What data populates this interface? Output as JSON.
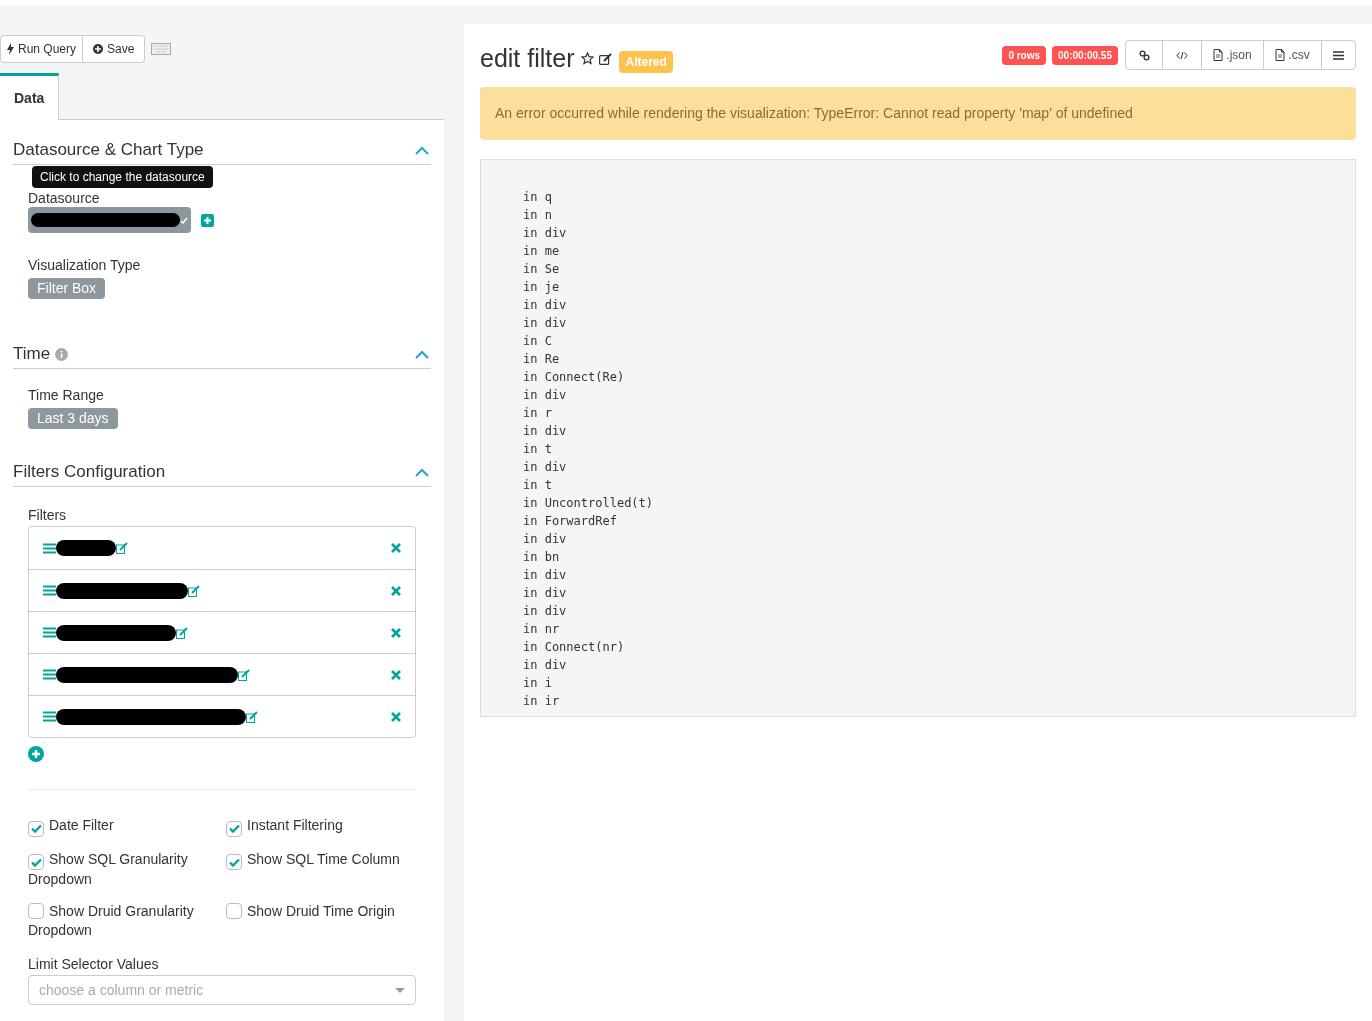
{
  "toolbar": {
    "run_button": "Run Query",
    "save_button": "Save"
  },
  "tabs": [
    {
      "label": "Data",
      "selected": true
    }
  ],
  "sections": [
    {
      "kind": "datasource",
      "title": "Datasource & Chart Type",
      "expanded": true,
      "datasource_label": "Datasource",
      "tooltip": "Click to change the datasource",
      "viz_label": "Visualization Type",
      "viz_value": "Filter Box"
    },
    {
      "kind": "time",
      "title": "Time",
      "expanded": true,
      "time_label": "Time Range",
      "time_value": "Last 3 days"
    },
    {
      "kind": "filters",
      "title": "Filters Configuration",
      "expanded": true,
      "filters_label": "Filters",
      "filters": [
        {
          "kind": "redacted"
        },
        {
          "kind": "redacted"
        },
        {
          "kind": "redacted"
        },
        {
          "kind": "redacted"
        },
        {
          "kind": "redacted"
        }
      ],
      "checkboxes": [
        {
          "label": "Date Filter",
          "checked": true
        },
        {
          "label": "Instant Filtering",
          "checked": true
        },
        {
          "label": "Show SQL Granularity Dropdown",
          "checked": true
        },
        {
          "label": "Show SQL Time Column",
          "checked": true
        },
        {
          "label": "Show Druid Granularity Dropdown",
          "checked": false
        },
        {
          "label": "Show Druid Time Origin",
          "checked": false
        }
      ],
      "limit_label": "Limit Selector Values",
      "limit_placeholder": "choose a column or metric"
    }
  ],
  "chart": {
    "title": "edit filter",
    "badge": "Altered",
    "rows": "0 rows",
    "timer": "00:00:00.55",
    "json_button": ".json",
    "csv_button": ".csv",
    "error": "An error occurred while rendering the visualization: TypeError: Cannot read property 'map' of undefined",
    "stack": [
      "in q",
      "in n",
      "in div",
      "in me",
      "in Se",
      "in je",
      "in div",
      "in div",
      "in C",
      "in Re",
      "in Connect(Re)",
      "in div",
      "in r",
      "in div",
      "in t",
      "in div",
      "in t",
      "in Uncontrolled(t)",
      "in ForwardRef",
      "in div",
      "in bn",
      "in div",
      "in div",
      "in div",
      "in nr",
      "in Connect(nr)",
      "in div",
      "in i",
      "in ir"
    ]
  }
}
